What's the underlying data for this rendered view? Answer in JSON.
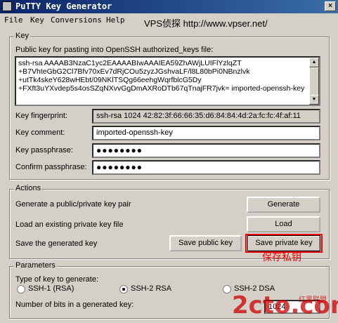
{
  "window": {
    "title": "PuTTY Key Generator",
    "close_glyph": "×"
  },
  "menu": [
    "File",
    "Key",
    "Conversions",
    "Help"
  ],
  "overlay_url": "VPS侦探 http://www.vpser.net/",
  "key_group": {
    "label": "Key",
    "pubkey_label": "Public key for pasting into OpenSSH authorized_keys file:",
    "pubkey_text": "ssh-rsa AAAAB3NzaC1yc2EAAAABIwAAAIEA59ZhAWjLUIFlYzlqZT\n+B7VhteGbG2Cl7Bfv70xEv7dRjCOu5zyzJGshvaLF/l8L80bPi0NBnzlvk\n+utTk4skeY628wHEbt/09NKlTSQg66eehgWqrfblcG5Dy\n+FXft3uYXvdep5s4osSZqNXvvGgDmAXRoDTb67qTnajFR7jvk= imported-openssh-key",
    "fingerprint_label": "Key fingerprint:",
    "fingerprint_value": "ssh-rsa 1024 42:82:3f:66:66:35:d6:84:84:4d:2a:fc:fc:4f:af:11",
    "comment_label": "Key comment:",
    "comment_value": "imported-openssh-key",
    "passphrase_label": "Key passphrase:",
    "passphrase_value": "●●●●●●●●",
    "confirm_label": "Confirm passphrase:",
    "confirm_value": "●●●●●●●●"
  },
  "actions_group": {
    "label": "Actions",
    "generate_text": "Generate a public/private key pair",
    "generate_button": "Generate",
    "load_text": "Load an existing private key file",
    "load_button": "Load",
    "save_text": "Save the generated key",
    "save_public_button": "Save public key",
    "save_private_button": "Save private key",
    "annotation": "保存私钥"
  },
  "params_group": {
    "label": "Parameters",
    "type_label": "Type of key to generate:",
    "radio_ssh1": "SSH-1 (RSA)",
    "radio_ssh2rsa": "SSH-2 RSA",
    "radio_ssh2dsa": "SSH-2 DSA",
    "selected": "SSH-2 RSA",
    "bits_label": "Number of bits in a generated key:",
    "bits_value": "1024"
  },
  "watermark": {
    "main": "2cto.com",
    "sub": "红黑联盟"
  }
}
